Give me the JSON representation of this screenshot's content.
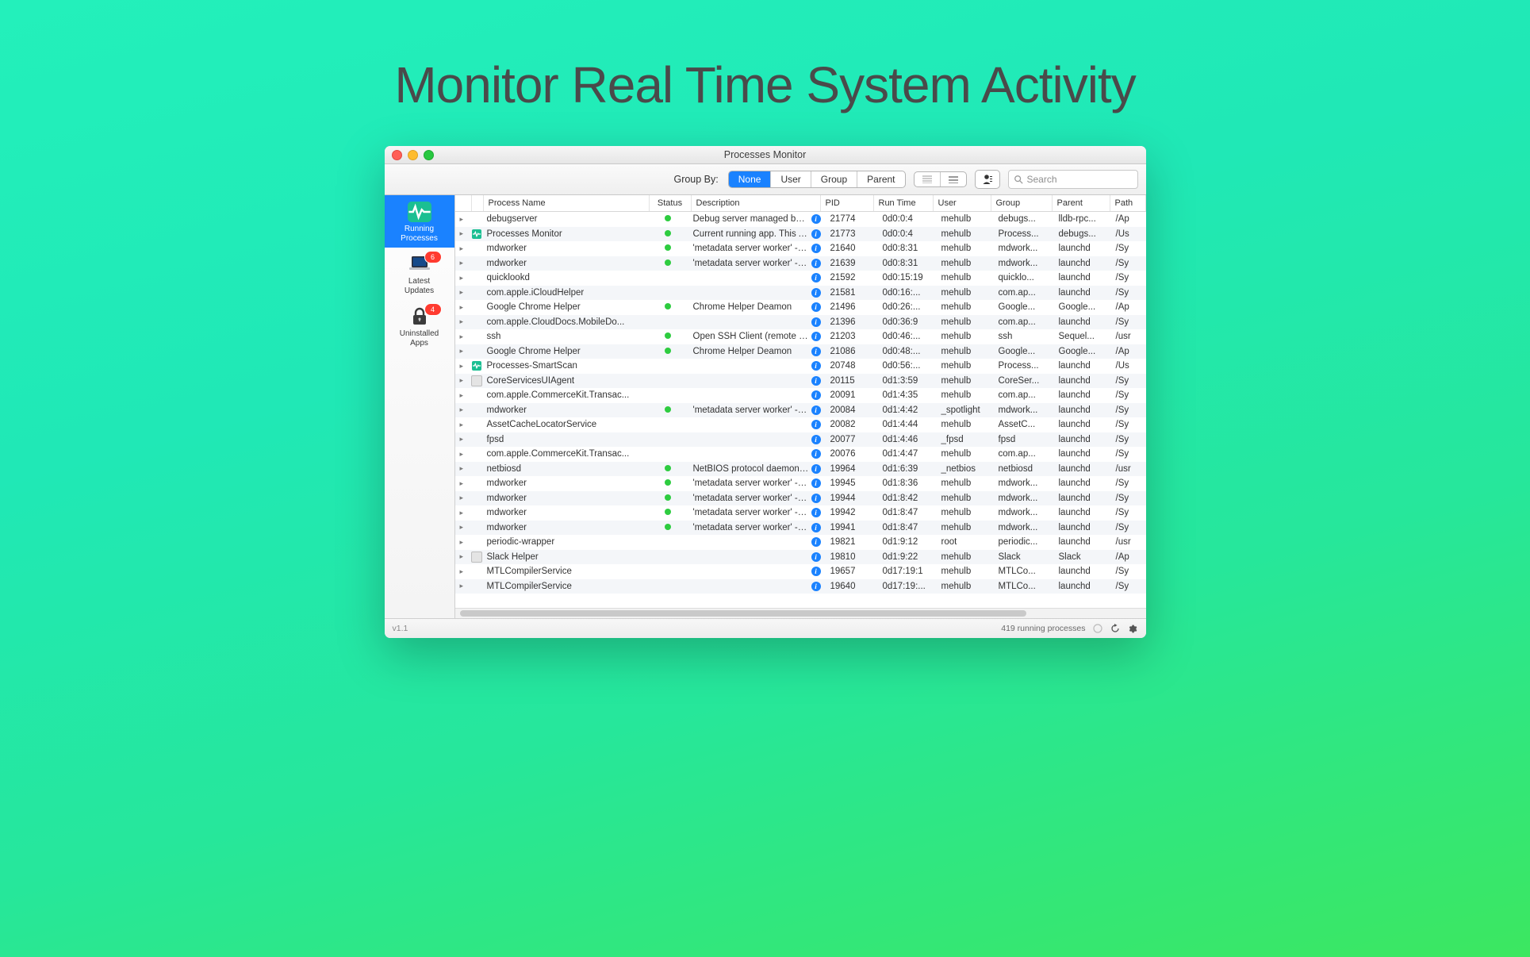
{
  "hero": "Monitor Real Time System Activity",
  "window": {
    "title": "Processes Monitor",
    "version": "v1.1"
  },
  "toolbar": {
    "group_by_label": "Group By:",
    "segments": [
      "None",
      "User",
      "Group",
      "Parent"
    ],
    "search_placeholder": "Search"
  },
  "sidebar": {
    "items": [
      {
        "label1": "Running",
        "label2": "Processes",
        "badge": null,
        "active": true,
        "icon": "pulse"
      },
      {
        "label1": "Latest",
        "label2": "Updates",
        "badge": "6",
        "active": false,
        "icon": "laptop"
      },
      {
        "label1": "Uninstalled",
        "label2": "Apps",
        "badge": "4",
        "active": false,
        "icon": "lock"
      }
    ]
  },
  "columns": {
    "name": "Process Name",
    "status": "Status",
    "desc": "Description",
    "pid": "PID",
    "run": "Run Time",
    "user": "User",
    "group": "Group",
    "parent": "Parent",
    "path": "Path"
  },
  "footer_status": "419 running processes",
  "rows": [
    {
      "ico": "",
      "name": "debugserver",
      "dot": true,
      "desc": "Debug server managed by xcode f...",
      "info": true,
      "pid": "21774",
      "run": "0d0:0:4",
      "user": "mehulb",
      "group": "debugs...",
      "parent": "lldb-rpc...",
      "path": "/Ap"
    },
    {
      "ico": "proc",
      "name": "Processes Monitor",
      "dot": true,
      "desc": "Current running app. This App mo...",
      "info": true,
      "pid": "21773",
      "run": "0d0:0:4",
      "user": "mehulb",
      "group": "Process...",
      "parent": "debugs...",
      "path": "/Us"
    },
    {
      "ico": "",
      "name": "mdworker",
      "dot": true,
      "desc": "'metadata server worker' - A spotli...",
      "info": true,
      "pid": "21640",
      "run": "0d0:8:31",
      "user": "mehulb",
      "group": "mdwork...",
      "parent": "launchd",
      "path": "/Sy"
    },
    {
      "ico": "",
      "name": "mdworker",
      "dot": true,
      "desc": "'metadata server worker' - A spotli...",
      "info": true,
      "pid": "21639",
      "run": "0d0:8:31",
      "user": "mehulb",
      "group": "mdwork...",
      "parent": "launchd",
      "path": "/Sy"
    },
    {
      "ico": "",
      "name": "quicklookd",
      "dot": false,
      "desc": "",
      "info": true,
      "pid": "21592",
      "run": "0d0:15:19",
      "user": "mehulb",
      "group": "quicklo...",
      "parent": "launchd",
      "path": "/Sy"
    },
    {
      "ico": "",
      "name": "com.apple.iCloudHelper",
      "dot": false,
      "desc": "",
      "info": true,
      "pid": "21581",
      "run": "0d0:16:...",
      "user": "mehulb",
      "group": "com.ap...",
      "parent": "launchd",
      "path": "/Sy"
    },
    {
      "ico": "",
      "name": "Google Chrome Helper",
      "dot": true,
      "desc": "Chrome Helper Deamon",
      "info": true,
      "pid": "21496",
      "run": "0d0:26:...",
      "user": "mehulb",
      "group": "Google...",
      "parent": "Google...",
      "path": "/Ap"
    },
    {
      "ico": "",
      "name": "com.apple.CloudDocs.MobileDo...",
      "dot": false,
      "desc": "",
      "info": true,
      "pid": "21396",
      "run": "0d0:36:9",
      "user": "mehulb",
      "group": "com.ap...",
      "parent": "launchd",
      "path": "/Sy"
    },
    {
      "ico": "",
      "name": "ssh",
      "dot": true,
      "desc": "Open SSH Client (remote login pr...",
      "info": true,
      "pid": "21203",
      "run": "0d0:46:...",
      "user": "mehulb",
      "group": "ssh",
      "parent": "Sequel...",
      "path": "/usr"
    },
    {
      "ico": "",
      "name": "Google Chrome Helper",
      "dot": true,
      "desc": "Chrome Helper Deamon",
      "info": true,
      "pid": "21086",
      "run": "0d0:48:...",
      "user": "mehulb",
      "group": "Google...",
      "parent": "Google...",
      "path": "/Ap"
    },
    {
      "ico": "proc",
      "name": "Processes-SmartScan",
      "dot": false,
      "desc": "",
      "info": true,
      "pid": "20748",
      "run": "0d0:56:...",
      "user": "mehulb",
      "group": "Process...",
      "parent": "launchd",
      "path": "/Us"
    },
    {
      "ico": "gen",
      "name": "CoreServicesUIAgent",
      "dot": false,
      "desc": "",
      "info": true,
      "pid": "20115",
      "run": "0d1:3:59",
      "user": "mehulb",
      "group": "CoreSer...",
      "parent": "launchd",
      "path": "/Sy"
    },
    {
      "ico": "",
      "name": "com.apple.CommerceKit.Transac...",
      "dot": false,
      "desc": "",
      "info": true,
      "pid": "20091",
      "run": "0d1:4:35",
      "user": "mehulb",
      "group": "com.ap...",
      "parent": "launchd",
      "path": "/Sy"
    },
    {
      "ico": "",
      "name": "mdworker",
      "dot": true,
      "desc": "'metadata server worker' - A spotli...",
      "info": true,
      "pid": "20084",
      "run": "0d1:4:42",
      "user": "_spotlight",
      "group": "mdwork...",
      "parent": "launchd",
      "path": "/Sy"
    },
    {
      "ico": "",
      "name": "AssetCacheLocatorService",
      "dot": false,
      "desc": "",
      "info": true,
      "pid": "20082",
      "run": "0d1:4:44",
      "user": "mehulb",
      "group": "AssetC...",
      "parent": "launchd",
      "path": "/Sy"
    },
    {
      "ico": "",
      "name": "fpsd",
      "dot": false,
      "desc": "",
      "info": true,
      "pid": "20077",
      "run": "0d1:4:46",
      "user": "_fpsd",
      "group": "fpsd",
      "parent": "launchd",
      "path": "/Sy"
    },
    {
      "ico": "",
      "name": "com.apple.CommerceKit.Transac...",
      "dot": false,
      "desc": "",
      "info": true,
      "pid": "20076",
      "run": "0d1:4:47",
      "user": "mehulb",
      "group": "com.ap...",
      "parent": "launchd",
      "path": "/Sy"
    },
    {
      "ico": "",
      "name": "netbiosd",
      "dot": true,
      "desc": "NetBIOS protocol daemon. netbio...",
      "info": true,
      "pid": "19964",
      "run": "0d1:6:39",
      "user": "_netbios",
      "group": "netbiosd",
      "parent": "launchd",
      "path": "/usr"
    },
    {
      "ico": "",
      "name": "mdworker",
      "dot": true,
      "desc": "'metadata server worker' - A spotli...",
      "info": true,
      "pid": "19945",
      "run": "0d1:8:36",
      "user": "mehulb",
      "group": "mdwork...",
      "parent": "launchd",
      "path": "/Sy"
    },
    {
      "ico": "",
      "name": "mdworker",
      "dot": true,
      "desc": "'metadata server worker' - A spotli...",
      "info": true,
      "pid": "19944",
      "run": "0d1:8:42",
      "user": "mehulb",
      "group": "mdwork...",
      "parent": "launchd",
      "path": "/Sy"
    },
    {
      "ico": "",
      "name": "mdworker",
      "dot": true,
      "desc": "'metadata server worker' - A spotli...",
      "info": true,
      "pid": "19942",
      "run": "0d1:8:47",
      "user": "mehulb",
      "group": "mdwork...",
      "parent": "launchd",
      "path": "/Sy"
    },
    {
      "ico": "",
      "name": "mdworker",
      "dot": true,
      "desc": "'metadata server worker' - A spotli...",
      "info": true,
      "pid": "19941",
      "run": "0d1:8:47",
      "user": "mehulb",
      "group": "mdwork...",
      "parent": "launchd",
      "path": "/Sy"
    },
    {
      "ico": "",
      "name": "periodic-wrapper",
      "dot": false,
      "desc": "",
      "info": true,
      "pid": "19821",
      "run": "0d1:9:12",
      "user": "root",
      "group": "periodic...",
      "parent": "launchd",
      "path": "/usr"
    },
    {
      "ico": "gen",
      "name": "Slack Helper",
      "dot": false,
      "desc": "",
      "info": true,
      "pid": "19810",
      "run": "0d1:9:22",
      "user": "mehulb",
      "group": "Slack",
      "parent": "Slack",
      "path": "/Ap"
    },
    {
      "ico": "",
      "name": "MTLCompilerService",
      "dot": false,
      "desc": "",
      "info": true,
      "pid": "19657",
      "run": "0d17:19:1",
      "user": "mehulb",
      "group": "MTLCo...",
      "parent": "launchd",
      "path": "/Sy"
    },
    {
      "ico": "",
      "name": "MTLCompilerService",
      "dot": false,
      "desc": "",
      "info": true,
      "pid": "19640",
      "run": "0d17:19:...",
      "user": "mehulb",
      "group": "MTLCo...",
      "parent": "launchd",
      "path": "/Sy"
    }
  ]
}
